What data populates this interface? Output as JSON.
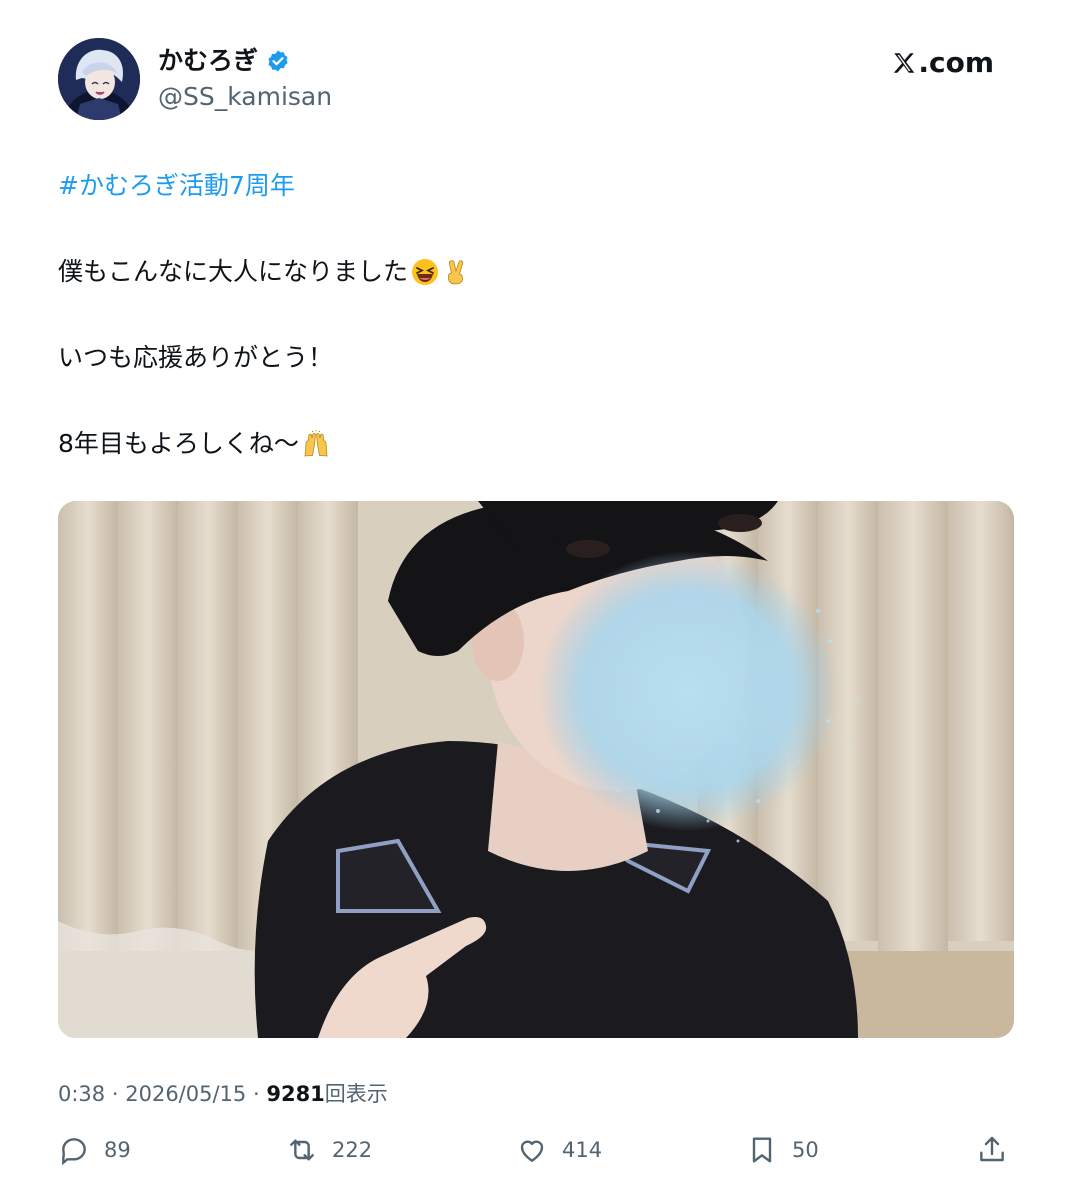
{
  "author": {
    "display_name": "かむろぎ",
    "handle": "@SS_kamisan",
    "verified_icon": "verified-badge-icon"
  },
  "brand": {
    "label": ".com",
    "icon": "x-logo-icon"
  },
  "tweet": {
    "hashtag": "#かむろぎ活動7周年",
    "line1": "僕もこんなに大人になりました",
    "line1_emojis": [
      "laughing-face-emoji",
      "victory-hand-emoji"
    ],
    "line2": "いつも応援ありがとう！",
    "line3": "8年目もよろしくね〜",
    "line3_emojis": [
      "raising-hands-emoji"
    ]
  },
  "meta": {
    "time": "0:38",
    "separator": "·",
    "date": "2026/05/15",
    "views_count": "9281",
    "views_label": "回表示"
  },
  "actions": {
    "replies": "89",
    "reposts": "222",
    "likes": "414",
    "bookmarks": "50"
  },
  "colors": {
    "accent": "#1d9bf0",
    "text": "#0f1419",
    "muted": "#536471"
  }
}
